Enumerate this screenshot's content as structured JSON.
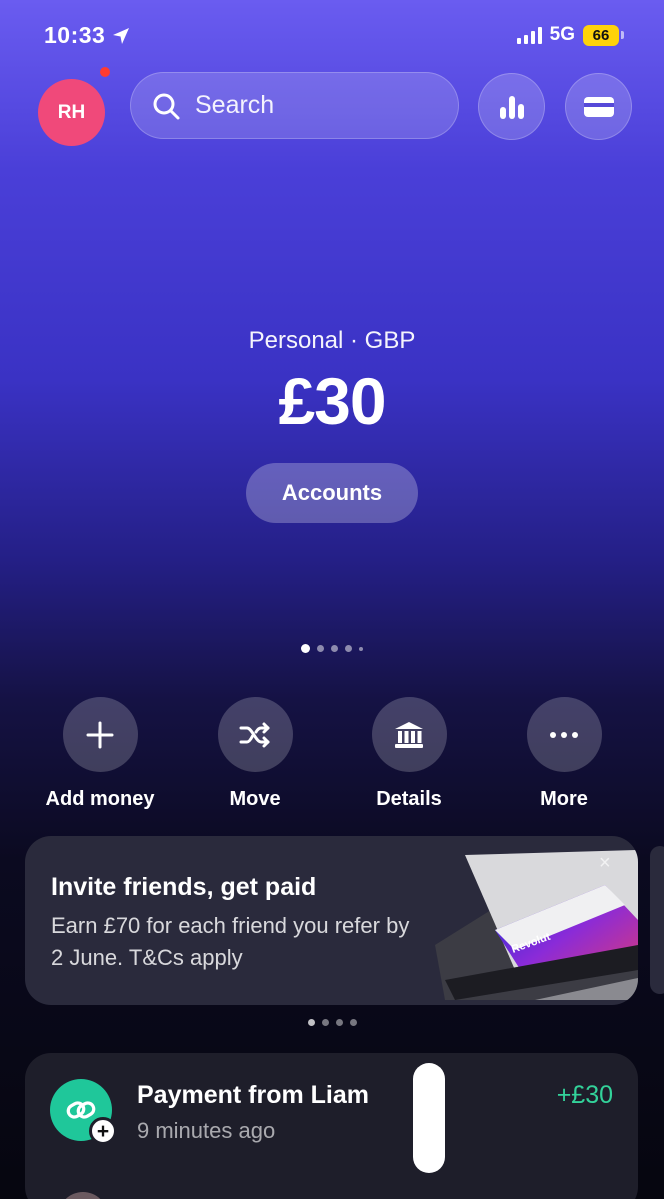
{
  "status_bar": {
    "time": "10:33",
    "network": "5G",
    "battery": "66",
    "icons": [
      "location-arrow-icon",
      "signal-bars-icon",
      "battery-icon"
    ]
  },
  "header": {
    "avatar_initials": "RH",
    "search_placeholder": "Search",
    "icons": [
      "search-icon",
      "analytics-icon",
      "card-icon"
    ]
  },
  "balance": {
    "account_label": "Personal · GBP",
    "amount": "£30",
    "accounts_button": "Accounts"
  },
  "actions": [
    {
      "label": "Add money",
      "icon": "plus-icon"
    },
    {
      "label": "Move",
      "icon": "shuffle-icon"
    },
    {
      "label": "Details",
      "icon": "bank-icon"
    },
    {
      "label": "More",
      "icon": "more-dots-icon"
    }
  ],
  "promo": {
    "title": "Invite friends, get paid",
    "body": "Earn £70 for each friend you refer by 2 June. T&Cs apply",
    "close": "×",
    "card_brand": "Revolut"
  },
  "transactions": [
    {
      "title": "Payment from Liam",
      "time": "9 minutes ago",
      "amount": "+£30",
      "icon": "link-icon"
    }
  ],
  "colors": {
    "accent": "#4a3fd8",
    "avatar": "#f0497a",
    "positive": "#33d29a",
    "battery": "#ffd30a"
  }
}
